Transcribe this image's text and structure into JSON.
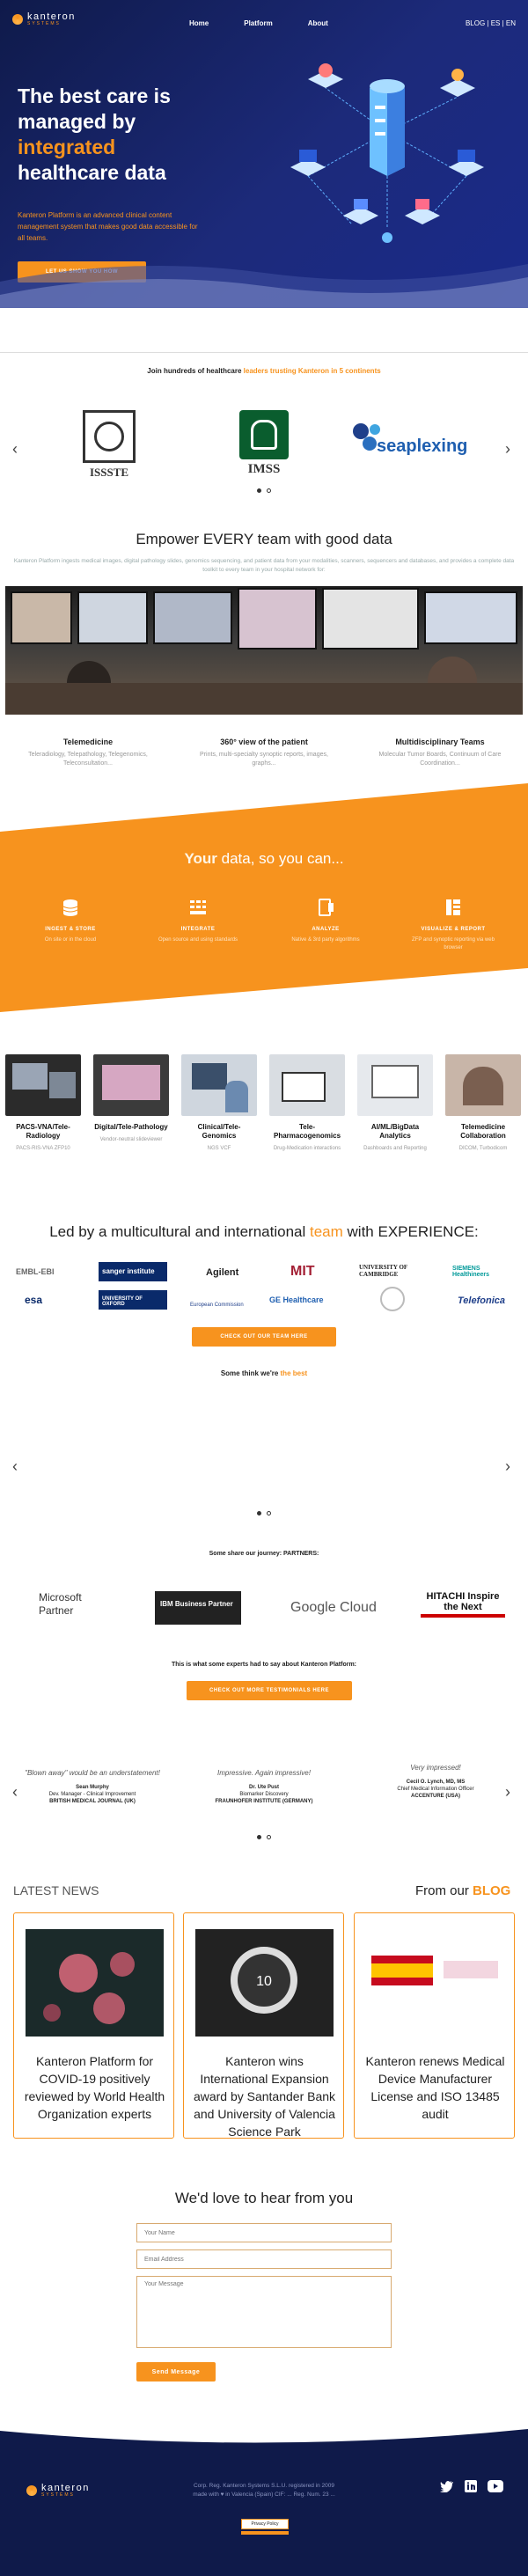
{
  "brand": {
    "name": "kanteron",
    "tagline": "SYSTEMS"
  },
  "nav": {
    "items": [
      "Home",
      "Platform",
      "About"
    ],
    "lang": "BLOG | ES | EN"
  },
  "hero": {
    "title_a": "The best care is managed by",
    "title_hl": "integrated",
    "title_b": "healthcare data",
    "subtitle": "Kanteron Platform is an advanced clinical content management system that makes good data accessible for all teams.",
    "cta": "LET US SHOW YOU HOW"
  },
  "trust": {
    "text_a": "Join hundreds of healthcare ",
    "text_hl": "leaders trusting Kanteron in 5 continents",
    "logos": [
      "ISSSTE",
      "IMSS",
      "seaplexing"
    ]
  },
  "teams": {
    "title": "Empower EVERY team with good data",
    "subtitle": "Kanteron Platform ingests medical images, digital pathology slides, genomics sequencing, and patient data from your modalities, scanners, sequencers and databases, and provides a complete data toolkit to every team in your hospital network for:",
    "features": [
      {
        "title": "Telemedicine",
        "desc": "Teleradiology, Telepathology, Telegenomics, Teleconsultation..."
      },
      {
        "title": "360° view of the patient",
        "desc": "Prints, multi-specialty synoptic reports, images, graphs..."
      },
      {
        "title": "Multidisciplinary Teams",
        "desc": "Molecular Tumor Boards, Continuum of Care Coordination..."
      }
    ]
  },
  "yourdata": {
    "title_hl": "Your",
    "title_rest": " data, so you can...",
    "items": [
      {
        "title": "INGEST & STORE",
        "desc": "On site or in the cloud"
      },
      {
        "title": "INTEGRATE",
        "desc": "Open source and using standards"
      },
      {
        "title": "ANALYZE",
        "desc": "Native & 3rd party algorithms"
      },
      {
        "title": "VISUALIZE & REPORT",
        "desc": "ZFP and synoptic reporting via web browser"
      }
    ]
  },
  "modules": [
    {
      "title": "PACS-VNA/Tele-Radiology",
      "desc": "PACS-RIS-VNA ZFP10"
    },
    {
      "title": "Digital/Tele-Pathology",
      "desc": "Vendor-neutral slideviewer"
    },
    {
      "title": "Clinical/Tele-Genomics",
      "desc": "NGS VCF"
    },
    {
      "title": "Tele-Pharmacogenomics",
      "desc": "Drug-Medication interactions"
    },
    {
      "title": "AI/ML/BigData Analytics",
      "desc": "Dashboards and Reporting"
    },
    {
      "title": "Telemedicine Collaboration",
      "desc": "DICOM, Turbodicom"
    }
  ],
  "team": {
    "title_a": "Led by a multicultural and international ",
    "title_hl": "team",
    "title_b": " with EXPERIENCE:",
    "logos": [
      "EMBL-EBI",
      "sanger institute",
      "Agilent",
      "MIT",
      "UNIVERSITY OF CAMBRIDGE",
      "SIEMENS Healthineers",
      "esa",
      "UNIVERSITY OF OXFORD",
      "European Commission",
      "GE Healthcare",
      "Telefonica"
    ],
    "cta": "CHECK OUT OUR TEAM HERE",
    "think_a": "Some think we're ",
    "think_hl": "the best"
  },
  "partners": {
    "title": "Some share our journey: PARTNERS:",
    "logos": [
      "Microsoft Partner",
      "IBM Business Partner",
      "Google Cloud",
      "HITACHI Inspire the Next"
    ]
  },
  "experts": {
    "title": "This is what some experts had to say about Kanteron Platform:",
    "cta": "CHECK OUT MORE TESTIMONIALS HERE",
    "quotes": [
      {
        "quote": "\"Blown away\" would be an understatement!",
        "name": "Sean Murphy",
        "role": "Dev. Manager - Clinical Improvement",
        "org": "BRITISH MEDICAL JOURNAL (UK)"
      },
      {
        "quote": "Impressive. Again impressive!",
        "name": "Dr. Ute Pust",
        "role": "Biomarker Discovery",
        "org": "FRAUNHOFER INSTITUTE (GERMANY)"
      },
      {
        "quote": "Very impressed!",
        "name": "Cecil O. Lynch, MD, MS",
        "role": "Chief Medical Information Officer",
        "org": "ACCENTURE (USA)"
      }
    ]
  },
  "news": {
    "title": "LATEST NEWS",
    "blog_a": "From our ",
    "blog_hl": "BLOG",
    "items": [
      {
        "title": "Kanteron Platform for COVID-19 positively reviewed by World Health Organization experts"
      },
      {
        "title": "Kanteron wins International Expansion award by Santander Bank and University of Valencia Science Park"
      },
      {
        "title": "Kanteron renews Medical Device Manufacturer License and ISO 13485 audit"
      }
    ]
  },
  "contact": {
    "title": "We'd love to hear from you",
    "name_ph": "Your Name",
    "email_ph": "Email Address",
    "msg_ph": "Your Message",
    "send": "Send Message"
  },
  "footer": {
    "line1": "Corp. Reg. Kanteron Systems S.L.U. registered in 2009",
    "line2": "made with ♥ in Valencia (Spain) CIF: ... Reg. Num. 23 ...",
    "privacy": "Privacy Policy"
  },
  "colors": {
    "accent": "#f7931e",
    "navy": "#0f1a4a"
  }
}
